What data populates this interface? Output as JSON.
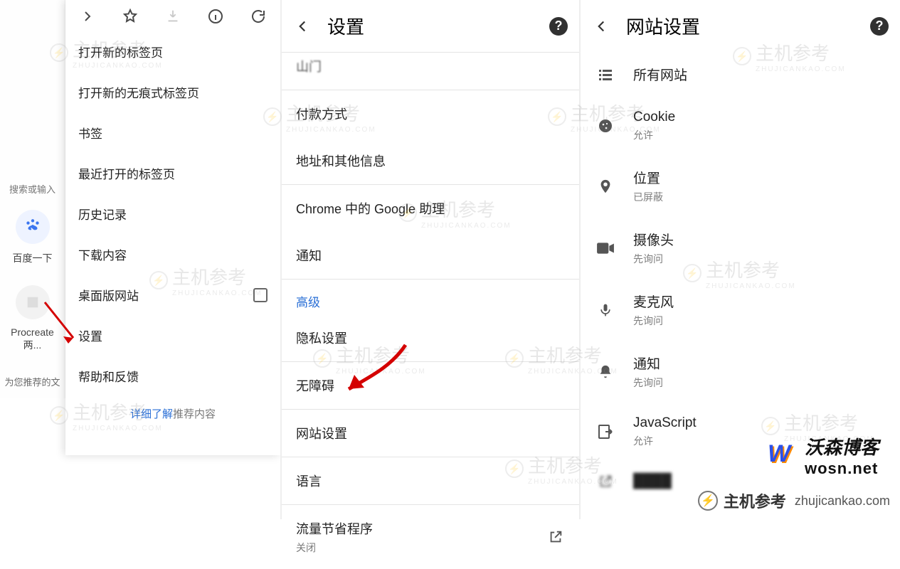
{
  "panel1": {
    "sliver": {
      "search_placeholder": "搜索或输入",
      "chip_label": "百度一下",
      "chip2_label": "Procreate两...",
      "rec_label": "为您推荐的文"
    },
    "menu": {
      "items": [
        "打开新的标签页",
        "打开新的无痕式标签页",
        "书签",
        "最近打开的标签页",
        "历史记录",
        "下载内容",
        "桌面版网站",
        "设置",
        "帮助和反馈"
      ],
      "learn_more_link": "详细了解",
      "learn_more_rest": "推荐内容"
    }
  },
  "panel2": {
    "title": "设置",
    "cut_top": "山门",
    "groups": [
      {
        "items": [
          "付款方式",
          "地址和其他信息"
        ]
      },
      {
        "items": [
          "Chrome 中的 Google 助理",
          "通知"
        ]
      }
    ],
    "advanced_label": "高级",
    "advanced_items": [
      "隐私设置",
      "无障碍",
      "网站设置",
      "语言"
    ],
    "data_saver": {
      "title": "流量节省程序",
      "sub": "关闭"
    }
  },
  "panel3": {
    "title": "网站设置",
    "rows": [
      {
        "icon": "list",
        "title": "所有网站",
        "sub": ""
      },
      {
        "icon": "cookie",
        "title": "Cookie",
        "sub": "允许"
      },
      {
        "icon": "location",
        "title": "位置",
        "sub": "已屏蔽"
      },
      {
        "icon": "camera",
        "title": "摄像头",
        "sub": "先询问"
      },
      {
        "icon": "mic",
        "title": "麦克风",
        "sub": "先询问"
      },
      {
        "icon": "bell",
        "title": "通知",
        "sub": "先询问"
      },
      {
        "icon": "js",
        "title": "JavaScript",
        "sub": "允许"
      },
      {
        "icon": "open",
        "title": "",
        "sub": ""
      }
    ]
  },
  "watermark": {
    "text": "主机参考",
    "sub": "ZHUJICANKAO.COM"
  },
  "branding": {
    "wosn_name": "沃森博客",
    "wosn_domain": "wosn.net",
    "zjck_name": "主机参考",
    "zjck_domain": "zhujicankao.com"
  }
}
